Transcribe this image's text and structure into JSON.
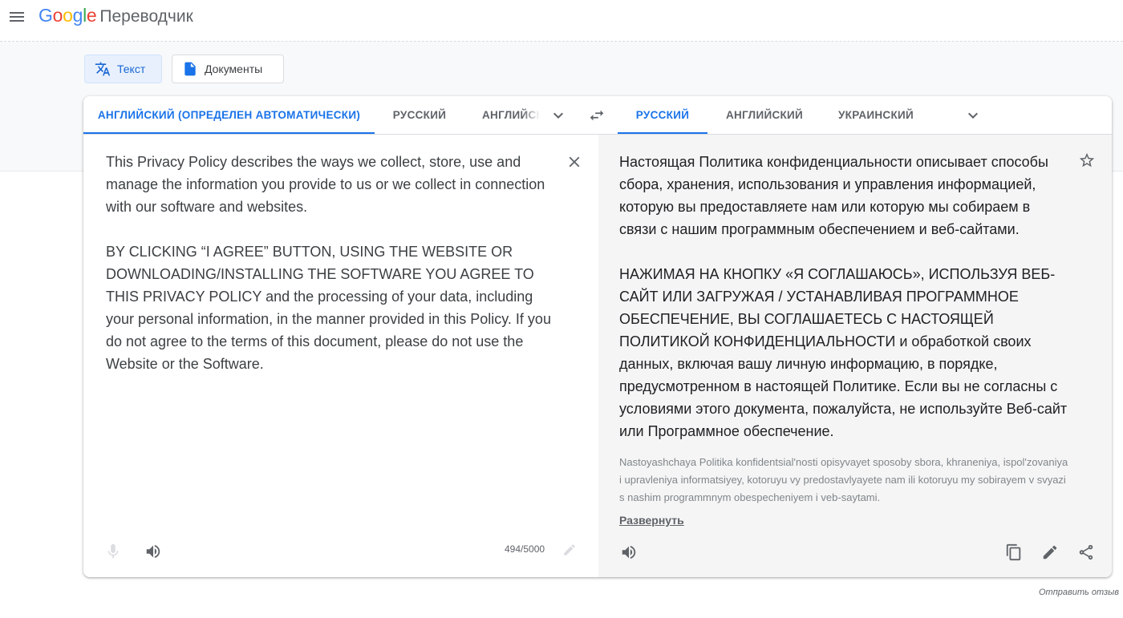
{
  "app": {
    "logo_text": "Google",
    "product_name": "Переводчик"
  },
  "modes": {
    "text_label": "Текст",
    "documents_label": "Документы"
  },
  "source_langs": {
    "detected": "АНГЛИЙСКИЙ (ОПРЕДЕЛЕН АВТОМАТИЧЕСКИ)",
    "lang2": "РУССКИЙ",
    "lang3": "АНГЛИЙСКИЙ"
  },
  "target_langs": {
    "lang1": "РУССКИЙ",
    "lang2": "АНГЛИЙСКИЙ",
    "lang3": "УКРАИНСКИЙ"
  },
  "source": {
    "text": "This Privacy Policy describes the ways we collect, store, use and manage the information you provide to us or we collect in connection with our software and websites.\n\nBY CLICKING “I AGREE” BUTTON, USING THE WEBSITE OR DOWNLOADING/INSTALLING THE SOFTWARE YOU AGREE TO THIS PRIVACY POLICY and the processing of your data, including your personal information, in the manner provided in this Policy. If you do not agree to the terms of this document, please do not use the Website or the Software.",
    "char_count": "494/5000"
  },
  "target": {
    "text": "Настоящая Политика конфиденциальности описывает способы сбора, хранения, использования и управления информацией, которую вы предоставляете нам или которую мы собираем в связи с нашим программным обеспечением и веб-сайтами.\n\nНАЖИМАЯ НА КНОПКУ «Я СОГЛАШАЮСЬ», ИСПОЛЬЗУЯ ВЕБ-САЙТ ИЛИ ЗАГРУЖАЯ / УСТАНАВЛИВАЯ ПРОГРАММНОЕ ОБЕСПЕЧЕНИЕ, ВЫ СОГЛАШАЕТЕСЬ С НАСТОЯЩЕЙ ПОЛИТИКОЙ КОНФИДЕНЦИАЛЬНОСТИ и обработкой своих данных, включая вашу личную информацию, в порядке, предусмотренном в настоящей Политике. Если вы не согласны с условиями этого документа, пожалуйста, не используйте Веб-сайт или Программное обеспечение.",
    "transliteration": "Nastoyashchaya Politika konfidentsial'nosti opisyvayet sposoby sbora, khraneniya, ispol'zovaniya i upravleniya informatsiyey, kotoruyu vy predostavlyayete nam ili kotoruyu my sobirayem v svyazi s nashim programmnym obespecheniyem i veb-saytami.",
    "expand_label": "Развернуть"
  },
  "footer": {
    "feedback_label": "Отправить отзыв"
  },
  "colors": {
    "accent": "#1a73e8",
    "active_mode_bg": "#e8f0fe",
    "target_panel_bg": "#f5f5f5"
  },
  "icons": [
    "menu-icon",
    "translate-icon",
    "document-icon",
    "chevron-down-icon",
    "swap-icon",
    "close-icon",
    "star-icon",
    "microphone-icon",
    "speaker-icon",
    "pencil-icon",
    "copy-icon",
    "share-icon"
  ]
}
